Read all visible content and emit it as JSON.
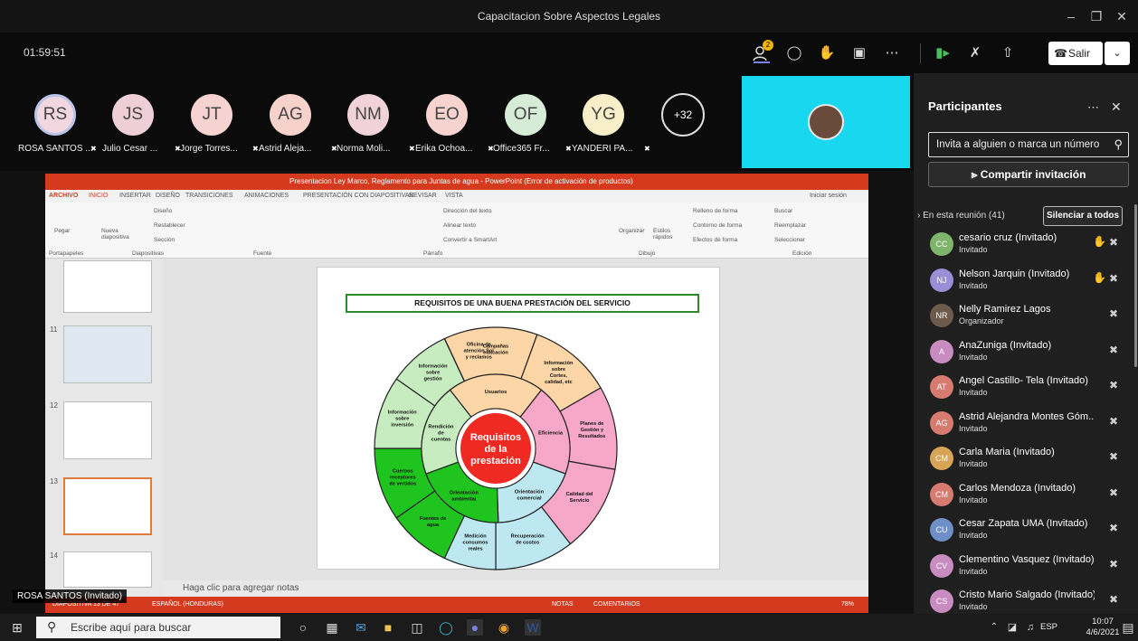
{
  "window": {
    "title": "Capacitacion Sobre Aspectos Legales"
  },
  "controls": {
    "timer": "01:59:51",
    "people_badge": "2",
    "leave_label": "Salir"
  },
  "participants_strip": [
    {
      "initials": "RS",
      "name": "ROSA SANTOS ...",
      "color": "#f2d6e0"
    },
    {
      "initials": "JS",
      "name": "Julio Cesar ...",
      "color": "#efcfd7"
    },
    {
      "initials": "JT",
      "name": "Jorge Torres...",
      "color": "#f6d3d0"
    },
    {
      "initials": "AG",
      "name": "Astrid Aleja...",
      "color": "#f7d2cb"
    },
    {
      "initials": "NM",
      "name": "Norma Moli...",
      "color": "#f0d2d8"
    },
    {
      "initials": "EO",
      "name": "Erika Ochoa...",
      "color": "#f7d3cf"
    },
    {
      "initials": "OF",
      "name": "Office365 Fr...",
      "color": "#d6ecd6"
    },
    {
      "initials": "YG",
      "name": "YANDERI PA...",
      "color": "#f8efc8"
    }
  ],
  "more_count": "+32",
  "panel": {
    "title": "Participantes",
    "invite_placeholder": "Invita a alguien o marca un número",
    "share_label": "Compartir invitación",
    "in_meeting": "En esta reunión (41)",
    "mute_all": "Silenciar a todos",
    "people": [
      {
        "initials": "CC",
        "name": "cesario cruz (Invitado)",
        "role": "Invitado",
        "hand": true,
        "color": "#7fb46c"
      },
      {
        "initials": "NJ",
        "name": "Nelson Jarquin (Invitado)",
        "role": "Invitado",
        "hand": true,
        "color": "#9a8fd6"
      },
      {
        "initials": "NR",
        "name": "Nelly Ramirez Lagos",
        "role": "Organizador",
        "hand": false,
        "color": "#6c5a4a"
      },
      {
        "initials": "A",
        "name": "AnaZuniga (Invitado)",
        "role": "Invitado",
        "hand": false,
        "color": "#c98cc0"
      },
      {
        "initials": "AT",
        "name": "Angel Castillo- Tela (Invitado)",
        "role": "Invitado",
        "hand": false,
        "color": "#d77a70"
      },
      {
        "initials": "AG",
        "name": "Astrid Alejandra Montes Góm...",
        "role": "Invitado",
        "hand": false,
        "color": "#d77a70"
      },
      {
        "initials": "CM",
        "name": "Carla Maria (Invitado)",
        "role": "Invitado",
        "hand": false,
        "color": "#d8a456"
      },
      {
        "initials": "CM",
        "name": "Carlos Mendoza (Invitado)",
        "role": "Invitado",
        "hand": false,
        "color": "#d77a70"
      },
      {
        "initials": "CU",
        "name": "Cesar Zapata UMA (Invitado)",
        "role": "Invitado",
        "hand": false,
        "color": "#6e8fc7"
      },
      {
        "initials": "CV",
        "name": "Clementino Vasquez (Invitado)",
        "role": "Invitado",
        "hand": false,
        "color": "#c98cc0"
      },
      {
        "initials": "CS",
        "name": "Cristo Mario Salgado (Invitado)",
        "role": "Invitado",
        "hand": false,
        "color": "#c98cc0"
      }
    ]
  },
  "ppt": {
    "title": "Presentacion Ley Marco, Reglamento para Juntas de agua - PowerPoint (Error de activación de productos)",
    "tabs": [
      "ARCHIVO",
      "INICIO",
      "INSERTAR",
      "DISEÑO",
      "TRANSICIONES",
      "ANIMACIONES",
      "PRESENTACIÓN CON DIAPOSITIVAS",
      "REVISAR",
      "VISTA"
    ],
    "signin": "Iniciar sesión",
    "ribbon_groups": [
      "Portapapeles",
      "Diapositivas",
      "Fuente",
      "Párrafo",
      "Dibujo",
      "Edición"
    ],
    "ribbon_items": {
      "pegar": "Pegar",
      "nueva": "Nueva diapositiva",
      "diseno": "Diseño",
      "restablecer": "Restablecer",
      "seccion": "Sección",
      "organizar": "Organizar",
      "estilos": "Estilos rápidos",
      "buscar": "Buscar",
      "reemplazar": "Reemplazar",
      "seleccionar": "Seleccionar",
      "relleno": "Relleno de forma",
      "contorno": "Contorno de forma",
      "efectos": "Efectos de forma",
      "direccion": "Dirección del texto",
      "alinear": "Alinear texto",
      "convertir": "Convertir a SmartArt"
    },
    "thumb_numbers": [
      "11",
      "12",
      "13",
      "14"
    ],
    "slide_title": "REQUISITOS DE UNA BUENA PRESTACIÓN DEL SERVICIO",
    "center_text": [
      "Requisitos",
      "de la",
      "prestación"
    ],
    "outer_ring": [
      "Campañas educación",
      "Información sobre Cortes, calidad, etc",
      "Planes de Gestión y Resultados",
      "Calidad del Servicio",
      "Recuperación de costos",
      "Medición consumos reales",
      "Fuentes de agua",
      "Cuerpos receptores de vertidos",
      "Información sobre inversión",
      "Información sobre gestión",
      "Oficina de atención Sol y reclamos"
    ],
    "inner_ring": [
      "Usuarios",
      "Eficiencia",
      "Orientación comercial",
      "Orientación ambiental",
      "Rendición de cuentas"
    ],
    "notes_placeholder": "Haga clic para agregar notas",
    "status": {
      "slide": "DIAPOSITIVA 13 DE 47",
      "lang": "ESPAÑOL (HONDURAS)",
      "notas": "NOTAS",
      "comentarios": "COMENTARIOS",
      "zoom": "78%"
    }
  },
  "presenter_label": "ROSA SANTOS (Invitado)",
  "taskbar": {
    "search": "Escribe aquí para buscar",
    "lang": "ESP",
    "time": "10:07",
    "date": "4/6/2021"
  }
}
